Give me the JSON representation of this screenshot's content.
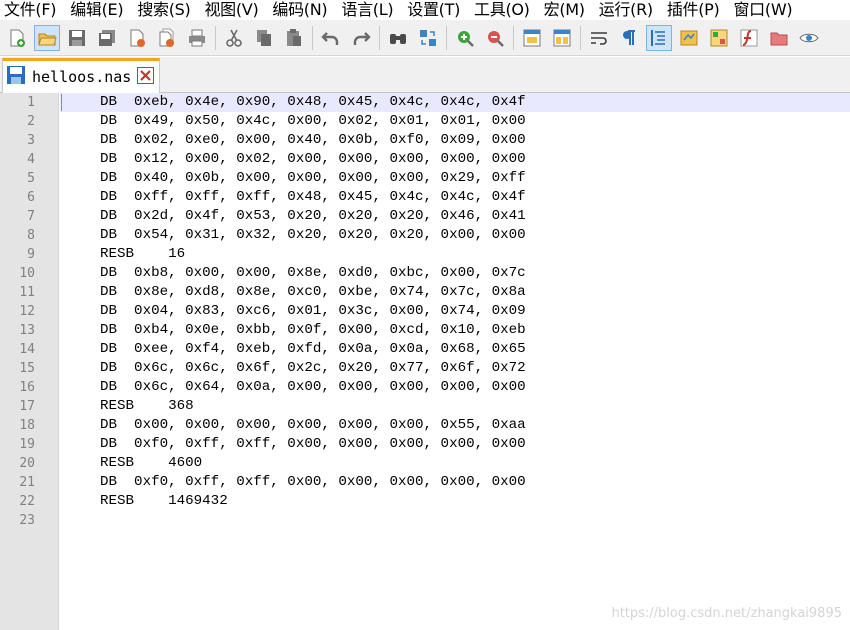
{
  "menu": [
    {
      "label": "文件(F)"
    },
    {
      "label": "编辑(E)"
    },
    {
      "label": "搜索(S)"
    },
    {
      "label": "视图(V)"
    },
    {
      "label": "编码(N)"
    },
    {
      "label": "语言(L)"
    },
    {
      "label": "设置(T)"
    },
    {
      "label": "工具(O)"
    },
    {
      "label": "宏(M)"
    },
    {
      "label": "运行(R)"
    },
    {
      "label": "插件(P)"
    },
    {
      "label": "窗口(W)"
    }
  ],
  "toolbar_icons": [
    "new-file-icon",
    "open-file-icon",
    "save-icon",
    "save-all-icon",
    "close-icon",
    "close-all-icon",
    "print-icon",
    "cut-icon",
    "copy-icon",
    "paste-icon",
    "undo-icon",
    "redo-icon",
    "find-icon",
    "replace-icon",
    "zoom-in-icon",
    "zoom-out-icon",
    "sync-vertical-icon",
    "sync-horizontal-icon",
    "word-wrap-icon",
    "show-all-chars-icon",
    "indent-guide-icon",
    "doc-map-icon",
    "function-list-icon",
    "folder-workspace-icon",
    "monitor-icon",
    "eye-icon"
  ],
  "tab": {
    "filename": "helloos.nas"
  },
  "lines": [
    {
      "num": "1",
      "text": "DB  0xeb, 0x4e, 0x90, 0x48, 0x45, 0x4c, 0x4c, 0x4f"
    },
    {
      "num": "2",
      "text": "DB  0x49, 0x50, 0x4c, 0x00, 0x02, 0x01, 0x01, 0x00"
    },
    {
      "num": "3",
      "text": "DB  0x02, 0xe0, 0x00, 0x40, 0x0b, 0xf0, 0x09, 0x00"
    },
    {
      "num": "4",
      "text": "DB  0x12, 0x00, 0x02, 0x00, 0x00, 0x00, 0x00, 0x00"
    },
    {
      "num": "5",
      "text": "DB  0x40, 0x0b, 0x00, 0x00, 0x00, 0x00, 0x29, 0xff"
    },
    {
      "num": "6",
      "text": "DB  0xff, 0xff, 0xff, 0x48, 0x45, 0x4c, 0x4c, 0x4f"
    },
    {
      "num": "7",
      "text": "DB  0x2d, 0x4f, 0x53, 0x20, 0x20, 0x20, 0x46, 0x41"
    },
    {
      "num": "8",
      "text": "DB  0x54, 0x31, 0x32, 0x20, 0x20, 0x20, 0x00, 0x00"
    },
    {
      "num": "9",
      "text": "RESB    16"
    },
    {
      "num": "10",
      "text": "DB  0xb8, 0x00, 0x00, 0x8e, 0xd0, 0xbc, 0x00, 0x7c"
    },
    {
      "num": "11",
      "text": "DB  0x8e, 0xd8, 0x8e, 0xc0, 0xbe, 0x74, 0x7c, 0x8a"
    },
    {
      "num": "12",
      "text": "DB  0x04, 0x83, 0xc6, 0x01, 0x3c, 0x00, 0x74, 0x09"
    },
    {
      "num": "13",
      "text": "DB  0xb4, 0x0e, 0xbb, 0x0f, 0x00, 0xcd, 0x10, 0xeb"
    },
    {
      "num": "14",
      "text": "DB  0xee, 0xf4, 0xeb, 0xfd, 0x0a, 0x0a, 0x68, 0x65"
    },
    {
      "num": "15",
      "text": "DB  0x6c, 0x6c, 0x6f, 0x2c, 0x20, 0x77, 0x6f, 0x72"
    },
    {
      "num": "16",
      "text": "DB  0x6c, 0x64, 0x0a, 0x00, 0x00, 0x00, 0x00, 0x00"
    },
    {
      "num": "17",
      "text": "RESB    368"
    },
    {
      "num": "18",
      "text": "DB  0x00, 0x00, 0x00, 0x00, 0x00, 0x00, 0x55, 0xaa"
    },
    {
      "num": "19",
      "text": "DB  0xf0, 0xff, 0xff, 0x00, 0x00, 0x00, 0x00, 0x00"
    },
    {
      "num": "20",
      "text": "RESB    4600"
    },
    {
      "num": "21",
      "text": "DB  0xf0, 0xff, 0xff, 0x00, 0x00, 0x00, 0x00, 0x00"
    },
    {
      "num": "22",
      "text": "RESB    1469432"
    },
    {
      "num": "23",
      "text": ""
    }
  ],
  "current_line": 1,
  "watermark": "https://blog.csdn.net/zhangkai9895",
  "colors": {
    "tab_accent": "#f7a41d",
    "current_line": "#e8e8ff",
    "gutter_bg": "#e4e4e4",
    "line_number": "#808080"
  }
}
